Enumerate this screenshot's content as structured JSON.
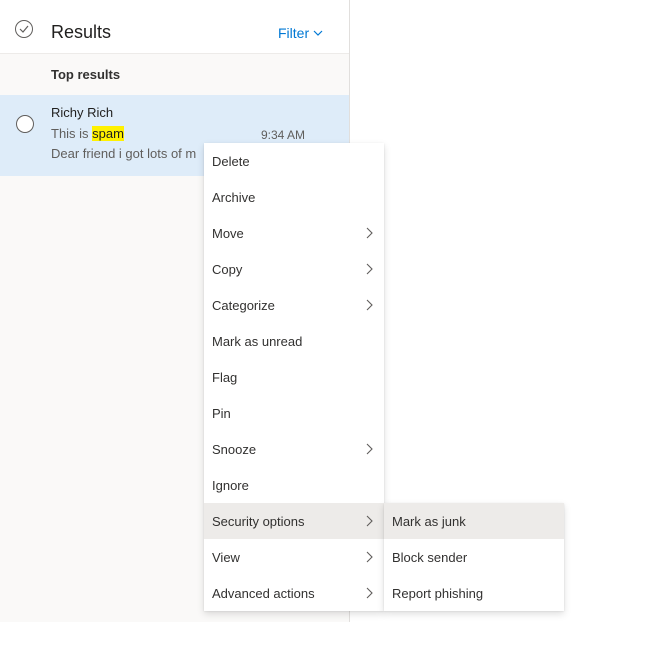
{
  "header": {
    "title": "Results",
    "filter_label": "Filter"
  },
  "section": {
    "label": "Top results"
  },
  "message": {
    "sender": "Richy Rich",
    "subject_prefix": "This is ",
    "subject_highlight": "spam",
    "time": "9:34 AM",
    "preview": "Dear friend i got lots of m"
  },
  "context_menu": {
    "items": [
      {
        "label": "Delete",
        "has_submenu": false
      },
      {
        "label": "Archive",
        "has_submenu": false
      },
      {
        "label": "Move",
        "has_submenu": true
      },
      {
        "label": "Copy",
        "has_submenu": true
      },
      {
        "label": "Categorize",
        "has_submenu": true
      },
      {
        "label": "Mark as unread",
        "has_submenu": false
      },
      {
        "label": "Flag",
        "has_submenu": false
      },
      {
        "label": "Pin",
        "has_submenu": false
      },
      {
        "label": "Snooze",
        "has_submenu": true
      },
      {
        "label": "Ignore",
        "has_submenu": false
      },
      {
        "label": "Security options",
        "has_submenu": true
      },
      {
        "label": "View",
        "has_submenu": true
      },
      {
        "label": "Advanced actions",
        "has_submenu": true
      }
    ]
  },
  "submenu": {
    "items": [
      {
        "label": "Mark as junk"
      },
      {
        "label": "Block sender"
      },
      {
        "label": "Report phishing"
      }
    ]
  },
  "colors": {
    "accent": "#0078d4",
    "selection": "#deecf9",
    "highlight": "#fff100"
  }
}
